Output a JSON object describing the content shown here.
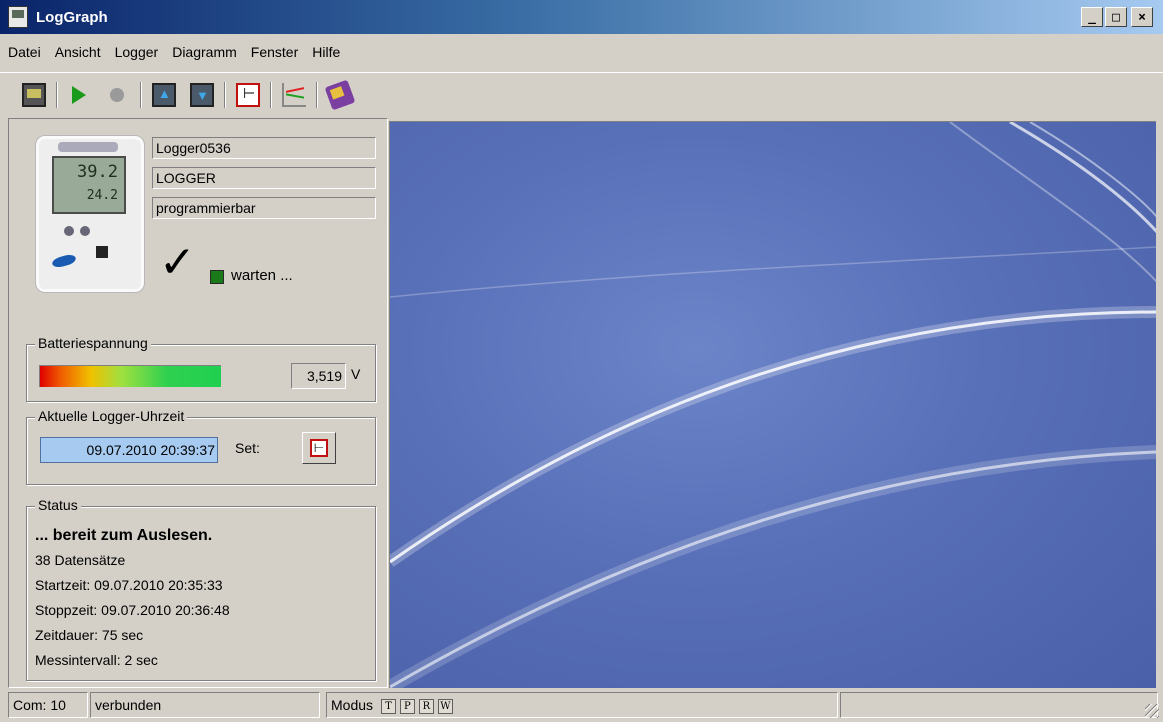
{
  "window": {
    "title": "LogGraph",
    "buttons": [
      "_",
      "□",
      "×"
    ]
  },
  "menu": [
    "Datei",
    "Ansicht",
    "Logger",
    "Diagramm",
    "Fenster",
    "Hilfe"
  ],
  "toolbar": {
    "icons": [
      "logger-icon",
      "play-icon",
      "record-icon",
      "upload-icon",
      "download-icon",
      "clock-icon",
      "chart-icon",
      "help-book-icon"
    ]
  },
  "device": {
    "name": "Logger0536",
    "type": "LOGGER",
    "mode": "programmierbar",
    "lcd_line1": "39.2",
    "lcd_line2": "24.2",
    "state_text": "warten ...",
    "state_color": "#1a7a1a"
  },
  "battery": {
    "title": "Batteriespannung",
    "value": "3,519",
    "unit": "V"
  },
  "clock": {
    "title": "Aktuelle Logger-Uhrzeit",
    "value": "09.07.2010 20:39:37",
    "set_label": "Set:"
  },
  "status": {
    "title": "Status",
    "headline": "... bereit zum Auslesen.",
    "records": "38 Datensätze",
    "start": "Startzeit: 09.07.2010 20:35:33",
    "stop": "Stoppzeit: 09.07.2010 20:36:48",
    "duration": "Zeitdauer: 75 sec",
    "interval": "Messintervall: 2 sec"
  },
  "statusbar": {
    "com": "Com: 10",
    "connection": "verbunden",
    "mode_label": "Modus",
    "modes": [
      "T",
      "P",
      "R",
      "W"
    ]
  }
}
